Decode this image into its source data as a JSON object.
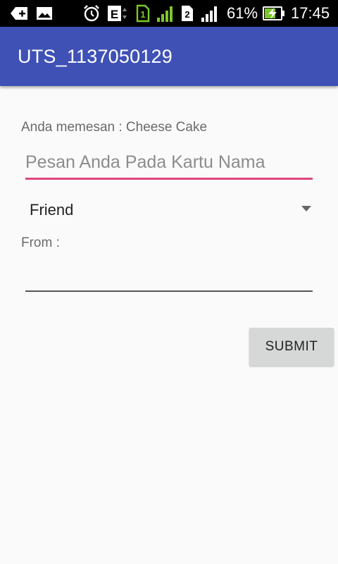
{
  "status_bar": {
    "sim1": "1",
    "sim2": "2",
    "network_type": "E",
    "battery_percent": "61%",
    "time": "17:45",
    "icons": [
      "add-notification-icon",
      "image-icon",
      "alarm-icon",
      "data-e-icon",
      "sim1-icon",
      "signal-icon",
      "sim2-icon",
      "signal-icon",
      "battery-charging-icon"
    ]
  },
  "app_bar": {
    "title": "UTS_1137050129"
  },
  "form": {
    "order_label": "Anda memesan : Cheese Cake",
    "message_placeholder": "Pesan Anda Pada Kartu Nama",
    "message_value": "",
    "recipient_selected": "Friend",
    "from_label": "From :",
    "from_value": "",
    "submit_label": "SUBMIT"
  },
  "colors": {
    "primary": "#3f51b5",
    "accent": "#e0457b",
    "background": "#fafafa"
  }
}
